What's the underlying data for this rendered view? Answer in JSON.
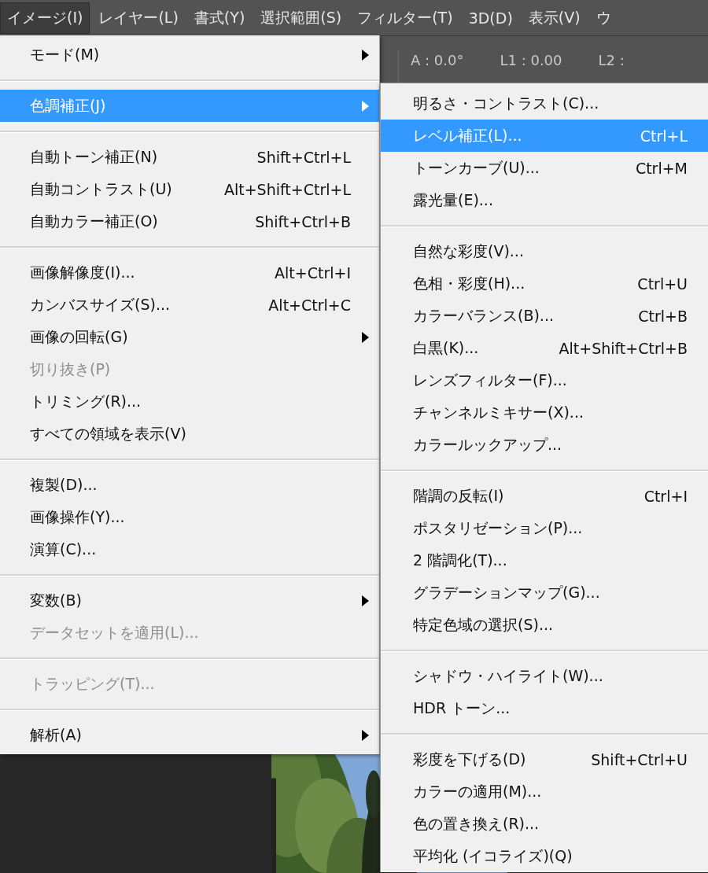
{
  "menubar": [
    {
      "label": "イメージ(I)",
      "selected": true
    },
    {
      "label": "レイヤー(L)",
      "selected": false
    },
    {
      "label": "書式(Y)",
      "selected": false
    },
    {
      "label": "選択範囲(S)",
      "selected": false
    },
    {
      "label": "フィルター(T)",
      "selected": false
    },
    {
      "label": "3D(D)",
      "selected": false
    },
    {
      "label": "表示(V)",
      "selected": false
    },
    {
      "label": "ウ",
      "selected": false
    }
  ],
  "options_bar": {
    "readouts": [
      "A : 0.0°",
      "L1 : 0.00",
      "L2 :"
    ]
  },
  "menu": {
    "items": [
      {
        "kind": "item",
        "label": "モード(M)",
        "has_submenu": true,
        "selected": false,
        "disabled": false
      },
      {
        "kind": "separator"
      },
      {
        "kind": "item",
        "label": "色調補正(J)",
        "has_submenu": true,
        "selected": true,
        "disabled": false
      },
      {
        "kind": "separator"
      },
      {
        "kind": "item",
        "label": "自動トーン補正(N)",
        "shortcut": "Shift+Ctrl+L",
        "has_submenu": false,
        "selected": false,
        "disabled": false
      },
      {
        "kind": "item",
        "label": "自動コントラスト(U)",
        "shortcut": "Alt+Shift+Ctrl+L",
        "has_submenu": false,
        "selected": false,
        "disabled": false
      },
      {
        "kind": "item",
        "label": "自動カラー補正(O)",
        "shortcut": "Shift+Ctrl+B",
        "has_submenu": false,
        "selected": false,
        "disabled": false
      },
      {
        "kind": "separator"
      },
      {
        "kind": "item",
        "label": "画像解像度(I)...",
        "shortcut": "Alt+Ctrl+I",
        "has_submenu": false,
        "selected": false,
        "disabled": false
      },
      {
        "kind": "item",
        "label": "カンバスサイズ(S)...",
        "shortcut": "Alt+Ctrl+C",
        "has_submenu": false,
        "selected": false,
        "disabled": false
      },
      {
        "kind": "item",
        "label": "画像の回転(G)",
        "has_submenu": true,
        "selected": false,
        "disabled": false
      },
      {
        "kind": "item",
        "label": "切り抜き(P)",
        "has_submenu": false,
        "selected": false,
        "disabled": true
      },
      {
        "kind": "item",
        "label": "トリミング(R)...",
        "has_submenu": false,
        "selected": false,
        "disabled": false
      },
      {
        "kind": "item",
        "label": "すべての領域を表示(V)",
        "has_submenu": false,
        "selected": false,
        "disabled": false
      },
      {
        "kind": "separator"
      },
      {
        "kind": "item",
        "label": "複製(D)...",
        "has_submenu": false,
        "selected": false,
        "disabled": false
      },
      {
        "kind": "item",
        "label": "画像操作(Y)...",
        "has_submenu": false,
        "selected": false,
        "disabled": false
      },
      {
        "kind": "item",
        "label": "演算(C)...",
        "has_submenu": false,
        "selected": false,
        "disabled": false
      },
      {
        "kind": "separator"
      },
      {
        "kind": "item",
        "label": "変数(B)",
        "has_submenu": true,
        "selected": false,
        "disabled": false
      },
      {
        "kind": "item",
        "label": "データセットを適用(L)...",
        "has_submenu": false,
        "selected": false,
        "disabled": true
      },
      {
        "kind": "separator"
      },
      {
        "kind": "item",
        "label": "トラッピング(T)...",
        "has_submenu": false,
        "selected": false,
        "disabled": true
      },
      {
        "kind": "separator"
      },
      {
        "kind": "item",
        "label": "解析(A)",
        "has_submenu": true,
        "selected": false,
        "disabled": false
      }
    ]
  },
  "submenu": {
    "items": [
      {
        "kind": "item",
        "label": "明るさ・コントラスト(C)...",
        "selected": false
      },
      {
        "kind": "item",
        "label": "レベル補正(L)...",
        "shortcut": "Ctrl+L",
        "selected": true
      },
      {
        "kind": "item",
        "label": "トーンカーブ(U)...",
        "shortcut": "Ctrl+M",
        "selected": false
      },
      {
        "kind": "item",
        "label": "露光量(E)...",
        "selected": false
      },
      {
        "kind": "separator"
      },
      {
        "kind": "item",
        "label": "自然な彩度(V)...",
        "selected": false
      },
      {
        "kind": "item",
        "label": "色相・彩度(H)...",
        "shortcut": "Ctrl+U",
        "selected": false
      },
      {
        "kind": "item",
        "label": "カラーバランス(B)...",
        "shortcut": "Ctrl+B",
        "selected": false
      },
      {
        "kind": "item",
        "label": "白黒(K)...",
        "shortcut": "Alt+Shift+Ctrl+B",
        "selected": false
      },
      {
        "kind": "item",
        "label": "レンズフィルター(F)...",
        "selected": false
      },
      {
        "kind": "item",
        "label": "チャンネルミキサー(X)...",
        "selected": false
      },
      {
        "kind": "item",
        "label": "カラールックアップ...",
        "selected": false
      },
      {
        "kind": "separator"
      },
      {
        "kind": "item",
        "label": "階調の反転(I)",
        "shortcut": "Ctrl+I",
        "selected": false
      },
      {
        "kind": "item",
        "label": "ポスタリゼーション(P)...",
        "selected": false
      },
      {
        "kind": "item",
        "label": "2 階調化(T)...",
        "selected": false
      },
      {
        "kind": "item",
        "label": "グラデーションマップ(G)...",
        "selected": false
      },
      {
        "kind": "item",
        "label": "特定色域の選択(S)...",
        "selected": false
      },
      {
        "kind": "separator"
      },
      {
        "kind": "item",
        "label": "シャドウ・ハイライト(W)...",
        "selected": false
      },
      {
        "kind": "item",
        "label": "HDR トーン...",
        "selected": false
      },
      {
        "kind": "separator"
      },
      {
        "kind": "item",
        "label": "彩度を下げる(D)",
        "shortcut": "Shift+Ctrl+U",
        "selected": false
      },
      {
        "kind": "item",
        "label": "カラーの適用(M)...",
        "selected": false
      },
      {
        "kind": "item",
        "label": "色の置き換え(R)...",
        "selected": false
      },
      {
        "kind": "item",
        "label": "平均化 (イコライズ)(Q)",
        "selected": false
      }
    ]
  }
}
